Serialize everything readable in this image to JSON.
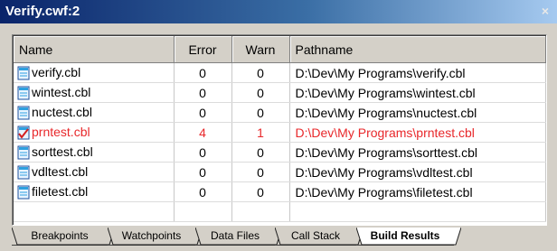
{
  "window": {
    "title": "Verify.cwf:2",
    "close_glyph": "×"
  },
  "columns": {
    "name": "Name",
    "error": "Error",
    "warn": "Warn",
    "path": "Pathname"
  },
  "rows": [
    {
      "name": "verify.cbl",
      "error": "0",
      "warn": "0",
      "path": "D:\\Dev\\My Programs\\verify.cbl",
      "icon": "cobol-file-icon",
      "status": "ok"
    },
    {
      "name": "wintest.cbl",
      "error": "0",
      "warn": "0",
      "path": "D:\\Dev\\My Programs\\wintest.cbl",
      "icon": "cobol-file-icon",
      "status": "ok"
    },
    {
      "name": "nuctest.cbl",
      "error": "0",
      "warn": "0",
      "path": "D:\\Dev\\My Programs\\nuctest.cbl",
      "icon": "cobol-file-icon",
      "status": "ok"
    },
    {
      "name": "prntest.cbl",
      "error": "4",
      "warn": "1",
      "path": "D:\\Dev\\My Programs\\prntest.cbl",
      "icon": "cobol-file-error-icon",
      "status": "error"
    },
    {
      "name": "sorttest.cbl",
      "error": "0",
      "warn": "0",
      "path": "D:\\Dev\\My Programs\\sorttest.cbl",
      "icon": "cobol-file-icon",
      "status": "ok"
    },
    {
      "name": "vdltest.cbl",
      "error": "0",
      "warn": "0",
      "path": "D:\\Dev\\My Programs\\vdltest.cbl",
      "icon": "cobol-file-icon",
      "status": "ok"
    },
    {
      "name": "filetest.cbl",
      "error": "0",
      "warn": "0",
      "path": "D:\\Dev\\My Programs\\filetest.cbl",
      "icon": "cobol-file-icon",
      "status": "ok"
    }
  ],
  "tabs": [
    {
      "label": "Breakpoints",
      "active": false
    },
    {
      "label": "Watchpoints",
      "active": false
    },
    {
      "label": "Data Files",
      "active": false
    },
    {
      "label": "Call Stack",
      "active": false
    },
    {
      "label": "Build Results",
      "active": true
    }
  ],
  "colors": {
    "error_text": "#e8282b",
    "title_start": "#0a246a",
    "title_end": "#a6caf0"
  }
}
